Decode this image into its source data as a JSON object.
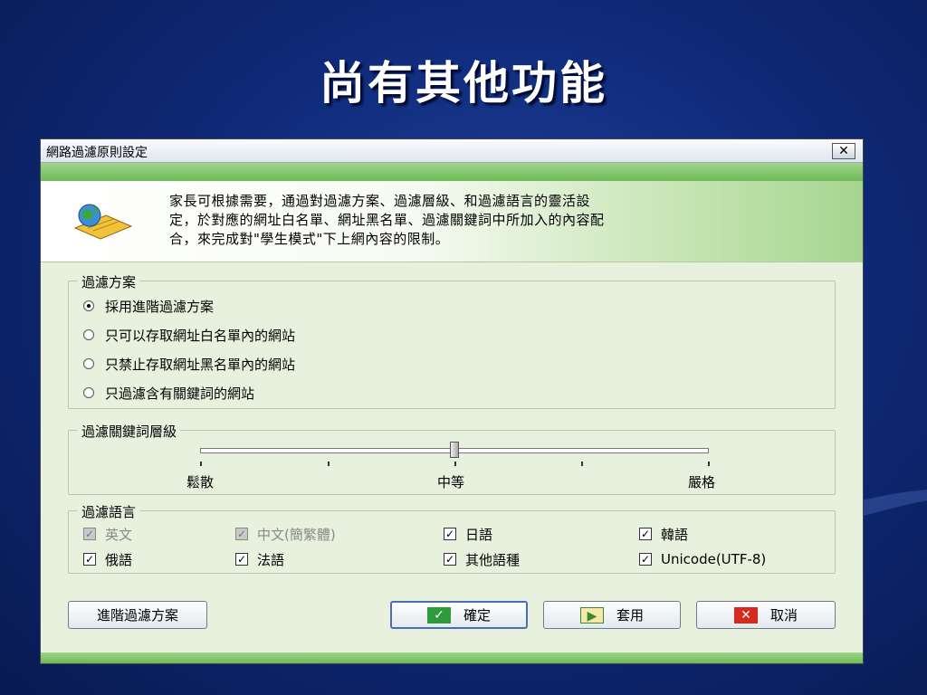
{
  "slide": {
    "title": "尚有其他功能"
  },
  "window": {
    "title": "網路過濾原則設定",
    "close_label": "✕"
  },
  "header": {
    "line1": "家長可根據需要，通過對過濾方案、過濾層級、和過濾語言的靈活設",
    "line2": "定，於對應的網址白名單、網址黑名單、過濾關鍵詞中所加入的內容配",
    "line3": "合，來完成對\"學生模式\"下上網內容的限制。"
  },
  "filter_scheme": {
    "legend": "過濾方案",
    "options": [
      {
        "label": "採用進階過濾方案",
        "selected": true
      },
      {
        "label": "只可以存取網址白名單內的網站",
        "selected": false
      },
      {
        "label": "只禁止存取網址黑名單內的網站",
        "selected": false
      },
      {
        "label": "只過濾含有關鍵詞的網站",
        "selected": false
      }
    ]
  },
  "keyword_level": {
    "legend": "過濾關鍵詞層級",
    "labels": {
      "low": "鬆散",
      "mid": "中等",
      "high": "嚴格"
    },
    "value_fraction": 0.5
  },
  "languages": {
    "legend": "過濾語言",
    "items": [
      {
        "label": "英文",
        "checked": true,
        "enabled": false
      },
      {
        "label": "中文(簡繁體)",
        "checked": true,
        "enabled": false
      },
      {
        "label": "日語",
        "checked": true,
        "enabled": true
      },
      {
        "label": "韓語",
        "checked": true,
        "enabled": true
      },
      {
        "label": "俄語",
        "checked": true,
        "enabled": true
      },
      {
        "label": "法語",
        "checked": true,
        "enabled": true
      },
      {
        "label": "其他語種",
        "checked": true,
        "enabled": true
      },
      {
        "label": "Unicode(UTF-8)",
        "checked": true,
        "enabled": true
      }
    ]
  },
  "buttons": {
    "advanced": "進階過濾方案",
    "ok": "確定",
    "apply": "套用",
    "cancel": "取消"
  },
  "colors": {
    "ok_icon": "#2e9b3a",
    "apply_icon": "#3a8a2a",
    "cancel_icon": "#d62a1e"
  }
}
